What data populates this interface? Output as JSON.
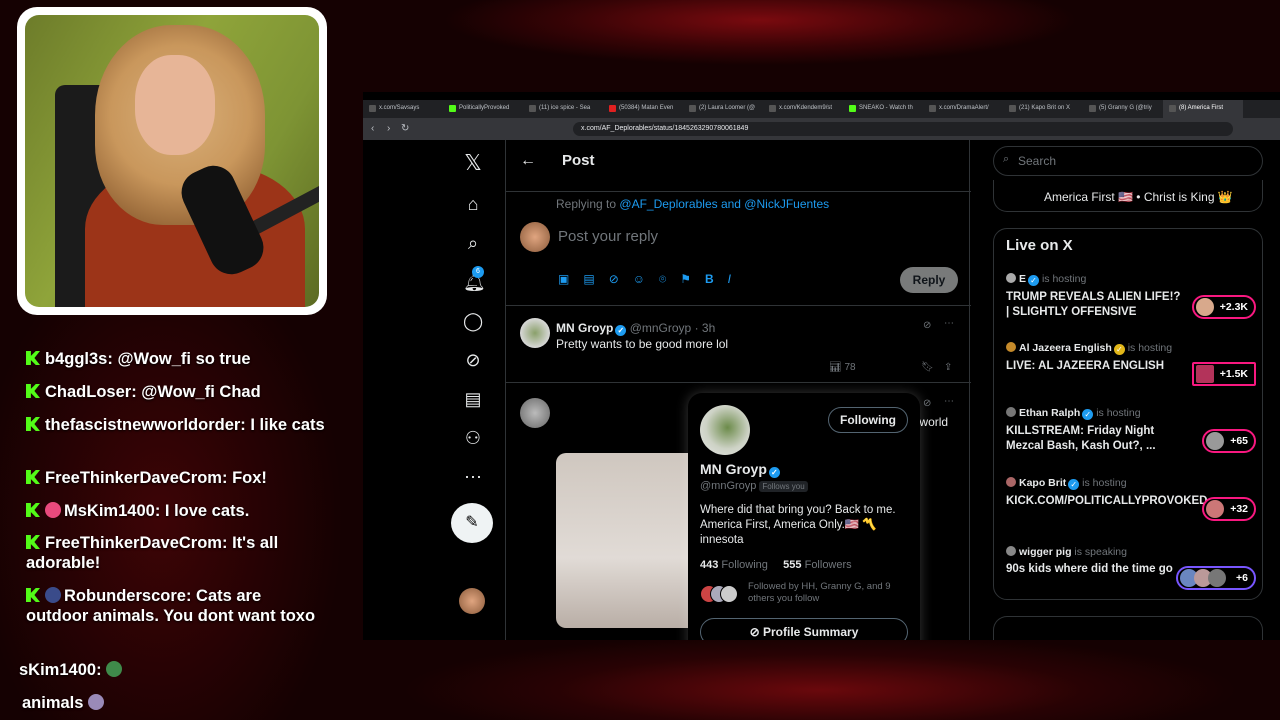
{
  "chat": [
    {
      "user": "b4ggl3s",
      "text": "@Wow_fi so true"
    },
    {
      "user": "ChadLoser",
      "text": "@Wow_fi Chad"
    },
    {
      "user": "thefascistnewworldorder",
      "text": "I like cats"
    },
    {
      "user": "FreeThinkerDaveCrom",
      "text": "Fox!"
    },
    {
      "user": "MsKim1400",
      "text": "I love cats."
    },
    {
      "user": "FreeThinkerDaveCrom",
      "text": "It's all adorable!"
    },
    {
      "user": "Robunderscore",
      "text": "Cats are outdoor animals. You dont want toxo"
    },
    {
      "user": "sKim1400",
      "text": ""
    },
    {
      "user": "",
      "text": "animals"
    }
  ],
  "browser": {
    "tabs": [
      "x.com/Savsays",
      "PoliticallyProvoked",
      "(11) ice spice - Sea",
      "(50384) Matan Even",
      "(2) Laura Loomer (@",
      "x.com/Kdendem9/st",
      "SNEAKO - Watch th",
      "x.com/DramaAlert/",
      "(21) Kapo Brit on X",
      "(5) Granny G (@triy",
      "(8) America First"
    ],
    "url": "x.com/AF_Deplorables/status/1845263290780061849"
  },
  "x": {
    "notif_count": "6",
    "header": {
      "title": "Post"
    },
    "replying_prefix": "Replying to",
    "replying_to": "@AF_Deplorables and @NickJFuentes",
    "composer_placeholder": "Post your reply",
    "reply_button": "Reply",
    "tweet1": {
      "name": "MN Groyp",
      "handle": "@mnGroyp",
      "time": "· 3h",
      "text": "Pretty wants to be good more lol",
      "views": "78"
    },
    "tweet2": {
      "text": "ates you, we hate you, the world"
    },
    "popup": {
      "follow_button": "Following",
      "name": "MN Groyp",
      "handle": "@mnGroyp",
      "follows_you": "Follows you",
      "bio": "Where did that bring you? Back to me. America First, America Only.🇺🇸 〽️innesota",
      "following_count": "443",
      "following_label": "Following",
      "followers_count": "555",
      "followers_label": "Followers",
      "followed_by": "Followed by HH, Granny G, and 9 others you follow",
      "summary_button": "Profile Summary"
    },
    "search_placeholder": "Search",
    "prev_card_text": "America First 🇺🇸 • Christ is King 👑",
    "live": {
      "title": "Live on X",
      "items": [
        {
          "host": "E",
          "status": "is hosting",
          "title": "TRUMP REVEALS ALIEN LIFE!? | SLIGHTLY OFFENSIVE",
          "count": "+2.3K"
        },
        {
          "host": "Al Jazeera English",
          "status": "is hosting",
          "title": "LIVE: AL JAZEERA ENGLISH",
          "count": "+1.5K"
        },
        {
          "host": "Ethan Ralph",
          "status": "is hosting",
          "title": "KILLSTREAM: Friday Night Mezcal Bash, Kash Out?, ...",
          "count": "+65"
        },
        {
          "host": "Kapo Brit",
          "status": "is hosting",
          "title": "KICK.COM/POLITICALLYPROVOKED",
          "count": "+32"
        },
        {
          "host": "wigger pig",
          "status": "is speaking",
          "title": "90s kids where did the time go",
          "count": "+6"
        }
      ]
    }
  }
}
